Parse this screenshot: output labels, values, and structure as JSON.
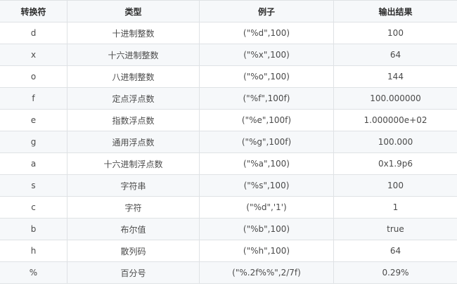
{
  "table": {
    "headers": [
      "转换符",
      "类型",
      "例子",
      "输出结果"
    ],
    "rows": [
      [
        "d",
        "十进制整数",
        "(\"%d\",100)",
        "100"
      ],
      [
        "x",
        "十六进制整数",
        "(\"%x\",100)",
        "64"
      ],
      [
        "o",
        "八进制整数",
        "(\"%o\",100)",
        "144"
      ],
      [
        "f",
        "定点浮点数",
        "(\"%f\",100f)",
        "100.000000"
      ],
      [
        "e",
        "指数浮点数",
        "(\"%e\",100f)",
        "1.000000e+02"
      ],
      [
        "g",
        "通用浮点数",
        "(\"%g\",100f)",
        "100.000"
      ],
      [
        "a",
        "十六进制浮点数",
        "(\"%a\",100)",
        "0x1.9p6"
      ],
      [
        "s",
        "字符串",
        "(\"%s\",100)",
        "100"
      ],
      [
        "c",
        "字符",
        "(\"%d\",'1')",
        "1"
      ],
      [
        "b",
        "布尔值",
        "(\"%b\",100)",
        "true"
      ],
      [
        "h",
        "散列码",
        "(\"%h\",100)",
        "64"
      ],
      [
        "%",
        "百分号",
        "(\"%.2f%%\",2/7f)",
        "0.29%"
      ]
    ]
  }
}
